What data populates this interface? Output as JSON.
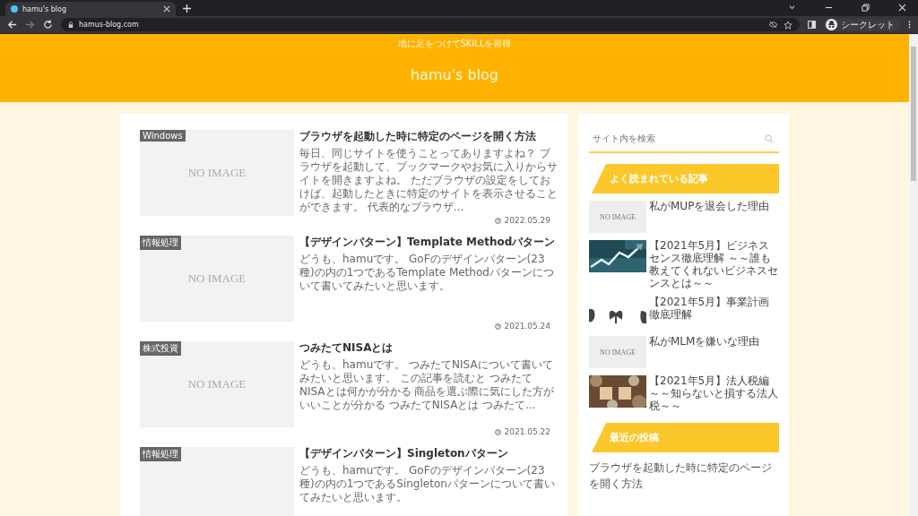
{
  "browser": {
    "tab": {
      "title": "hamu's blog",
      "selected": true
    },
    "url": "hamus-blog.com",
    "profile": "シークレット"
  },
  "header": {
    "tagline": "地に足をつけてSKILLを習得",
    "title": "hamu's blog"
  },
  "articles": [
    {
      "category": "Windows",
      "image_text": "NO IMAGE",
      "title": "ブラウザを起動した時に特定のページを開く方法",
      "excerpt": "毎日、同じサイトを使うことってありますよね？ ブラウザを起動して、ブックマークやお気に入りからサイトを開きますよね。 ただブラウザの設定をしておけば、起動したときに特定のサイトを表示させることができます。 代表的なブラウザ...",
      "date": "2022.05.29"
    },
    {
      "category": "情報処理",
      "image_text": "NO IMAGE",
      "title": "【デザインパターン】Template Methodパターン",
      "excerpt": "どうも、hamuです。 GoFのデザインパターン(23種)の内の1つであるTemplate Methodパターンについて書いてみたいと思います。",
      "date": "2021.05.24"
    },
    {
      "category": "株式投資",
      "image_text": "NO IMAGE",
      "title": "つみたてNISAとは",
      "excerpt": "どうも、hamuです。 つみたてNISAについて書いてみたいと思います。 この記事を読むと つみたてNISAとは何かが分かる 商品を選ぶ際に気にした方がいいことが分かる つみたてNISAとは つみたて...",
      "date": "2021.05.22"
    },
    {
      "category": "情報処理",
      "title": "【デザインパターン】Singletonパターン",
      "excerpt": "どうも、hamuです。 GoFのデザインパターン(23種)の内の1つであるSingletonパターンについて書いてみたいと思います。"
    }
  ],
  "sidebar": {
    "search": {
      "placeholder": "サイト内を検索"
    },
    "popular": {
      "heading": "よく読まれている記事",
      "items": [
        {
          "kind": "noimage",
          "image_text": "NO IMAGE",
          "title": "私がMUPを退会した理由"
        },
        {
          "kind": "picture",
          "title": "【2021年5月】ビジネスセンス徹底理解 ～～誰も教えてくれないビジネスセンスとは～～"
        },
        {
          "kind": "picture",
          "title": "【2021年5月】事業計画徹底理解"
        },
        {
          "kind": "noimage",
          "image_text": "NO IMAGE",
          "title": "私がMLMを嫌いな理由"
        },
        {
          "kind": "picture",
          "title": "【2021年5月】法人税編～～知らないと損する法人税～～"
        }
      ]
    },
    "recent": {
      "heading": "最近の投稿",
      "items": [
        "ブラウザを起動した時に特定のページを開く方法"
      ]
    }
  }
}
